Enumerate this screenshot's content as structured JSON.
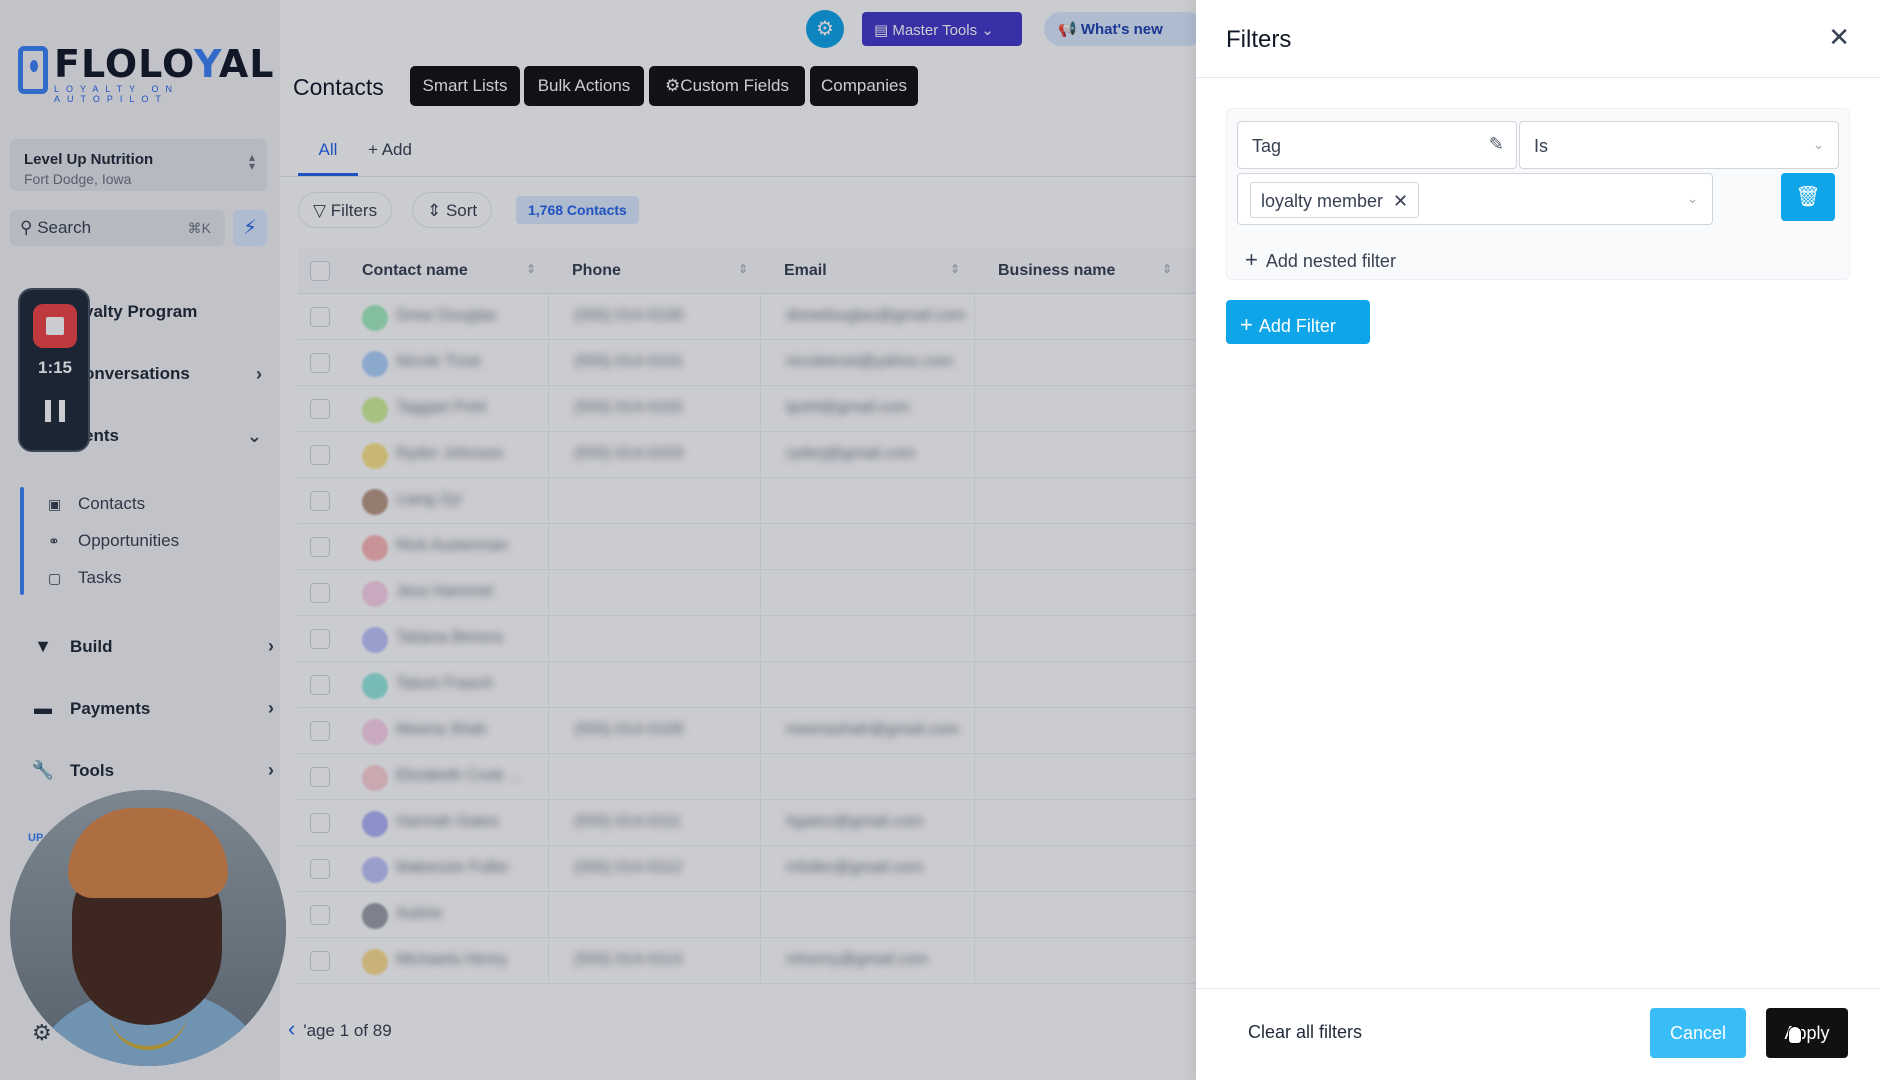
{
  "brand": {
    "name_a": "FLOLO",
    "name_b": "Y",
    "name_c": "AL",
    "tagline": "LOYALTY ON AUTOPILOT"
  },
  "location": {
    "name": "Level Up Nutrition",
    "sub": "Fort Dodge, Iowa"
  },
  "search": {
    "label": "Search",
    "shortcut": "⌘K"
  },
  "nav": {
    "loyalty": "yalty Program",
    "conversations": "onversations",
    "clients": "ents",
    "build": "Build",
    "payments": "Payments",
    "tools": "Tools",
    "upgrade": "UP"
  },
  "subnav": {
    "contacts": "Contacts",
    "opportunities": "Opportunities",
    "tasks": "Tasks"
  },
  "recorder": {
    "time": "1:15"
  },
  "topbar": {
    "master_tools": "Master Tools",
    "whats_new": "What's new"
  },
  "page": {
    "title": "Contacts"
  },
  "toptabs": [
    "Smart Lists",
    "Bulk Actions",
    "Custom Fields",
    "Companies"
  ],
  "views": {
    "all": "All",
    "add": "Add"
  },
  "toolbar": {
    "filters": "Filters",
    "sort": "Sort",
    "count": "1,768 Contacts"
  },
  "table": {
    "headers": [
      "Contact name",
      "Phone",
      "Email",
      "Business name"
    ],
    "rows": [
      {
        "name": "Drew Douglas",
        "phone": "(555) 014-0100",
        "email": "drewdouglas@gmail.com",
        "color": "#4ade80"
      },
      {
        "name": "Nicole Trost",
        "phone": "(555) 014-0101",
        "email": "nicoletrost@yahoo.com",
        "color": "#60a5fa"
      },
      {
        "name": "Taggart Pohl",
        "phone": "(555) 014-0102",
        "email": "tpohl@gmail.com",
        "color": "#a3e635"
      },
      {
        "name": "Ryder Johnson",
        "phone": "(555) 014-0103",
        "email": "ryderj@gmail.com",
        "color": "#facc15"
      },
      {
        "name": "Liang Zyl",
        "phone": "",
        "email": "",
        "color": "#78350f"
      },
      {
        "name": "Rick Austerman",
        "phone": "",
        "email": "",
        "color": "#f87171"
      },
      {
        "name": "Jess Hammel",
        "phone": "",
        "email": "",
        "color": "#f9a8d4"
      },
      {
        "name": "Tatiana Bimora",
        "phone": "",
        "email": "",
        "color": "#818cf8"
      },
      {
        "name": "Tatum Frasch",
        "phone": "",
        "email": "",
        "color": "#2dd4bf"
      },
      {
        "name": "Meena Shah",
        "phone": "(555) 014-0109",
        "email": "meenashah@gmail.com",
        "color": "#f9a8d4"
      },
      {
        "name": "Elizabeth Cook ...",
        "phone": "",
        "email": "",
        "color": "#fda4af"
      },
      {
        "name": "Hannah Gates",
        "phone": "(555) 014-0111",
        "email": "hgates@gmail.com",
        "color": "#6366f1"
      },
      {
        "name": "Makenzie Fuller",
        "phone": "(555) 014-0112",
        "email": "mfuller@gmail.com",
        "color": "#818cf8"
      },
      {
        "name": "Aubrie",
        "phone": "",
        "email": "",
        "color": "#374151"
      },
      {
        "name": "Michaela Henry",
        "phone": "(555) 014-0114",
        "email": "mhenry@gmail.com",
        "color": "#fbbf24"
      }
    ]
  },
  "pager": {
    "label": "'age 1 of 89"
  },
  "drawer": {
    "title": "Filters",
    "field": "Tag",
    "operator": "Is",
    "tag_value": "loyalty member",
    "nested": "Add nested filter",
    "add_filter": "Add Filter",
    "clear_all": "Clear all filters",
    "cancel": "Cancel",
    "apply": "Apply"
  }
}
